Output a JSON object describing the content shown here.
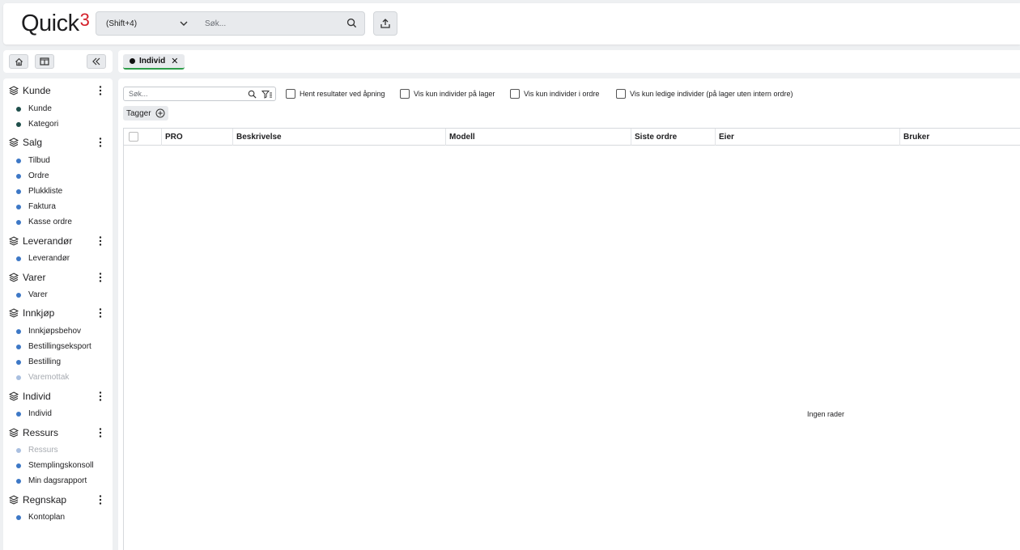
{
  "header": {
    "logo_text": "Quick",
    "logo_sup": "3",
    "shortcut": "(Shift+4)",
    "search_placeholder": "Søk..."
  },
  "tab": {
    "label": "Individ"
  },
  "sidebar": {
    "sections": [
      {
        "title": "Kunde",
        "items": [
          {
            "label": "Kunde",
            "state": "active"
          },
          {
            "label": "Kategori",
            "state": "active"
          }
        ]
      },
      {
        "title": "Salg",
        "items": [
          {
            "label": "Tilbud"
          },
          {
            "label": "Ordre"
          },
          {
            "label": "Plukkliste"
          },
          {
            "label": "Faktura"
          },
          {
            "label": "Kasse ordre"
          }
        ]
      },
      {
        "title": "Leverandør",
        "items": [
          {
            "label": "Leverandør"
          }
        ]
      },
      {
        "title": "Varer",
        "items": [
          {
            "label": "Varer"
          }
        ]
      },
      {
        "title": "Innkjøp",
        "items": [
          {
            "label": "Innkjøpsbehov"
          },
          {
            "label": "Bestillingseksport"
          },
          {
            "label": "Bestilling"
          },
          {
            "label": "Varemottak",
            "state": "disabled"
          }
        ]
      },
      {
        "title": "Individ",
        "items": [
          {
            "label": "Individ"
          }
        ]
      },
      {
        "title": "Ressurs",
        "items": [
          {
            "label": "Ressurs",
            "state": "disabled"
          },
          {
            "label": "Stemplingskonsoll"
          },
          {
            "label": "Min dagsrapport"
          }
        ]
      },
      {
        "title": "Regnskap",
        "items": [
          {
            "label": "Kontoplan"
          }
        ]
      }
    ]
  },
  "filters": {
    "search_placeholder": "Søk...",
    "options": [
      "Hent resultater ved åpning",
      "Vis kun individer på lager",
      "Vis kun individer i ordre",
      "Vis kun ledige individer (på lager uten intern ordre)"
    ],
    "tags_label": "Tagger"
  },
  "grid": {
    "columns": [
      "PRO",
      "Beskrivelse",
      "Modell",
      "Siste ordre",
      "Eier",
      "Bruker"
    ],
    "empty_text": "Ingen rader"
  },
  "colors": {
    "dot_blue": "#3d78c6",
    "dot_dark_teal": "#1f4f4b",
    "dot_disabled": "#a9bfe0",
    "tab_underline": "#2e9d4a",
    "logo_accent": "#d4202a"
  }
}
